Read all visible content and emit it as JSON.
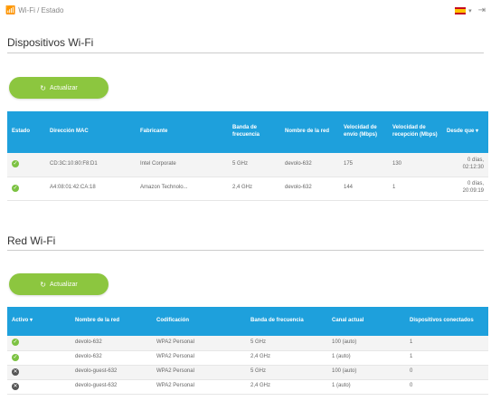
{
  "header": {
    "breadcrumb": "Wi-Fi / Estado",
    "language_flag": "es",
    "colors": {
      "accent": "#1ea0dc",
      "button": "#8cc63f"
    }
  },
  "devices": {
    "title": "Dispositivos Wi-Fi",
    "refresh_label": "Actualizar",
    "columns": [
      "Estado",
      "Dirección MAC",
      "Fabricante",
      "Banda de frecuencia",
      "Nombre de la red",
      "Velocidad de envío (Mbps)",
      "Velocidad de recepción (Mbps)",
      "Desde que ▾"
    ],
    "rows": [
      {
        "status": "ok",
        "mac": "CD:3C:10:80:F8:D1",
        "maker": "Intel Corporate",
        "band": "5 GHz",
        "ssid": "devolo-632",
        "tx": "175",
        "rx": "130",
        "since": "0 días, 02:12:30"
      },
      {
        "status": "ok",
        "mac": "A4:08:01:42:CA:18",
        "maker": "Amazon Technolo...",
        "band": "2,4 GHz",
        "ssid": "devolo-632",
        "tx": "144",
        "rx": "1",
        "since": "0 días, 20:09:19"
      }
    ]
  },
  "networks": {
    "title": "Red Wi-Fi",
    "refresh_label": "Actualizar",
    "columns": [
      "Activo ▾",
      "Nombre de la red",
      "Codificación",
      "Banda de frecuencia",
      "Canal actual",
      "Dispositivos conectados"
    ],
    "rows": [
      {
        "status": "ok",
        "name": "devolo-632",
        "enc": "WPA2 Personal",
        "band": "5 GHz",
        "channel": "100 (auto)",
        "devices": "1"
      },
      {
        "status": "ok",
        "name": "devolo-632",
        "enc": "WPA2 Personal",
        "band": "2,4 GHz",
        "channel": "1 (auto)",
        "devices": "1"
      },
      {
        "status": "off",
        "name": "devolo-guest-632",
        "enc": "WPA2 Personal",
        "band": "5 GHz",
        "channel": "100 (auto)",
        "devices": "0"
      },
      {
        "status": "off",
        "name": "devolo-guest-632",
        "enc": "WPA2 Personal",
        "band": "2,4 GHz",
        "channel": "1 (auto)",
        "devices": "0"
      }
    ]
  }
}
